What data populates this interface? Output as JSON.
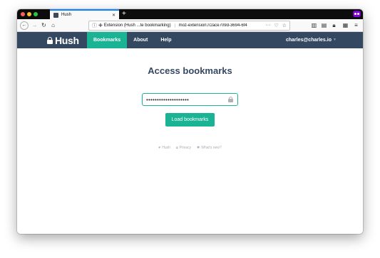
{
  "browser": {
    "tab_title": "Hush",
    "tab_close": "✕",
    "new_tab": "+",
    "url_identity": "Extension (Hush ...te bookmarking)",
    "url_text": "moz-extension://2ace709d-3694-6f4",
    "traffic_colors": [
      "#fe5f57",
      "#febc2e",
      "#28c840"
    ]
  },
  "app": {
    "logo_text": "Hush",
    "nav": [
      {
        "label": "Bookmarks",
        "active": true
      },
      {
        "label": "About",
        "active": false
      },
      {
        "label": "Help",
        "active": false
      }
    ],
    "user": "charles@charles.io",
    "accent_color": "#1ab394",
    "header_color": "#354862"
  },
  "main": {
    "heading": "Access bookmarks",
    "password_value": "••••••••••••••••••••",
    "load_button": "Load bookmarks"
  },
  "footer": {
    "links": [
      {
        "icon": "♥",
        "label": "Hush"
      },
      {
        "icon": "🔒︎",
        "label": "Privacy"
      },
      {
        "icon": "✱",
        "label": "What's new?"
      }
    ]
  }
}
